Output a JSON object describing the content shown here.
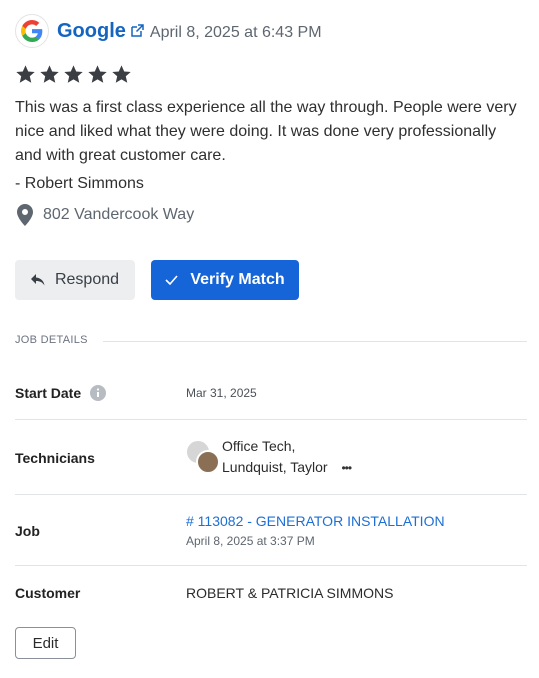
{
  "review": {
    "source": "Google",
    "date": "April 8, 2025 at 6:43 PM",
    "rating": 5,
    "text": "This was a first class experience all the way through. People were very nice and liked what they were doing. It was done very professionally and with great customer care.",
    "reviewer": "- Robert Simmons",
    "location": "802 Vandercook Way"
  },
  "actions": {
    "respond_label": "Respond",
    "verify_label": "Verify Match"
  },
  "job_details": {
    "section_label": "JOB DETAILS",
    "start_date_label": "Start Date",
    "start_date": "Mar 31, 2025",
    "technicians_label": "Technicians",
    "technicians_line1": "Office Tech,",
    "technicians_line2": "Lundquist, Taylor",
    "job_label": "Job",
    "job_link": "# 113082 - GENERATOR INSTALLATION",
    "job_date": "April 8, 2025 at 3:37 PM",
    "customer_label": "Customer",
    "customer": "ROBERT & PATRICIA SIMMONS"
  },
  "edit_label": "Edit",
  "colors": {
    "primary": "#1565d8",
    "link": "#1c6fd6",
    "star": "#3b3f44"
  },
  "icons": [
    "google-logo",
    "external-link-icon",
    "star-icon",
    "map-pin-icon",
    "reply-icon",
    "check-icon",
    "info-icon",
    "more-icon"
  ]
}
